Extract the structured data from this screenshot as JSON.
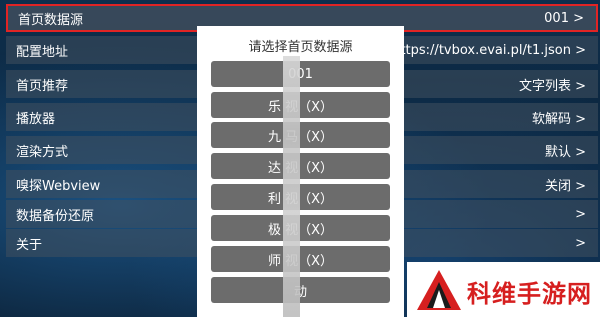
{
  "settings": {
    "rows": [
      {
        "label": "首页数据源",
        "value": "001 >"
      },
      {
        "label": "配置地址",
        "value": "https://tvbox.evai.pl/t1.json >"
      },
      {
        "label": "首页推荐",
        "value": "文字列表 >"
      },
      {
        "label": "播放器",
        "value": "软解码 >"
      },
      {
        "label": "渲染方式",
        "value": "默认 >"
      },
      {
        "label": "嗅探Webview",
        "value": "关闭 >"
      },
      {
        "label": "数据备份还原",
        "value": ">"
      },
      {
        "label": "关于",
        "value": ">"
      }
    ]
  },
  "dialog": {
    "title": "请选择首页数据源",
    "options": [
      "001",
      "乐 视（X）",
      "九 马（X）",
      "达 视（X）",
      "利 视（X）",
      "极 视（X）",
      "师 视（X）",
      "动 "
    ]
  },
  "watermark": {
    "text": "科维手游网"
  },
  "colors": {
    "selected_border": "#e02424",
    "option_bg": "#6c6c6c",
    "watermark_red": "#d61f1f"
  }
}
